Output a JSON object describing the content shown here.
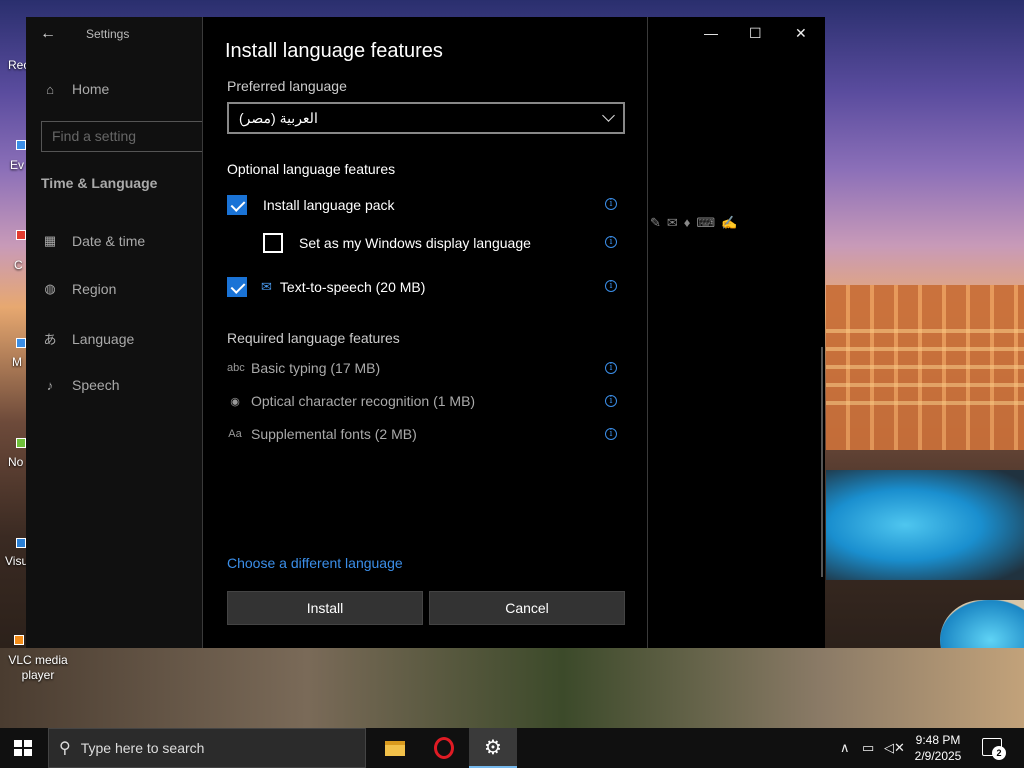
{
  "desktop": {
    "icons": [
      {
        "label": "Rec",
        "icon": "recycle-bin-icon"
      },
      {
        "label": "Ev",
        "icon": "shortcut-icon"
      },
      {
        "label": "C",
        "icon": "chrome-icon"
      },
      {
        "label": "M",
        "icon": "edge-icon"
      },
      {
        "label": "No",
        "icon": "notepad-icon"
      },
      {
        "label": "Visu",
        "icon": "vscode-icon"
      },
      {
        "label": "VLC media player",
        "icon": "vlc-icon"
      }
    ]
  },
  "settings": {
    "title": "Settings",
    "back_icon": "back-arrow-icon",
    "home_label": "Home",
    "search_placeholder": "Find a setting",
    "section": "Time & Language",
    "nav": [
      {
        "label": "Date & time",
        "icon": "calendar-clock-icon"
      },
      {
        "label": "Region",
        "icon": "globe-icon"
      },
      {
        "label": "Language",
        "icon": "language-icon"
      },
      {
        "label": "Speech",
        "icon": "microphone-icon"
      }
    ],
    "window_controls": {
      "minimize": "—",
      "maximize": "☐",
      "close": "✕"
    }
  },
  "dialog": {
    "title": "Install language features",
    "preferred_label": "Preferred language",
    "preferred_value": "العربية (مصر)",
    "optional_heading": "Optional language features",
    "optional": [
      {
        "label": "Install language pack",
        "checked": true
      },
      {
        "label": "Set as my Windows display language",
        "checked": false
      },
      {
        "label": "Text-to-speech (20 MB)",
        "checked": true,
        "icon": "text-to-speech-icon"
      }
    ],
    "required_heading": "Required language features",
    "required": [
      {
        "label": "Basic typing (17 MB)",
        "icon": "abc-typing-icon"
      },
      {
        "label": "Optical character recognition (1 MB)",
        "icon": "ocr-eye-icon"
      },
      {
        "label": "Supplemental fonts (2 MB)",
        "icon": "font-aa-icon"
      }
    ],
    "info_glyph": "i",
    "choose_link": "Choose a different language",
    "install_label": "Install",
    "cancel_label": "Cancel"
  },
  "taskbar": {
    "search_placeholder": "Type here to search",
    "apps": [
      {
        "name": "file-explorer-icon"
      },
      {
        "name": "opera-icon"
      },
      {
        "name": "settings-gear-icon",
        "active": true
      }
    ],
    "time": "9:48 PM",
    "date": "2/9/2025",
    "notification_count": "2"
  },
  "colors": {
    "accent": "#1a73d6",
    "link": "#3b8ee8",
    "dialog_bg": "#000000",
    "button_bg": "#333333"
  }
}
